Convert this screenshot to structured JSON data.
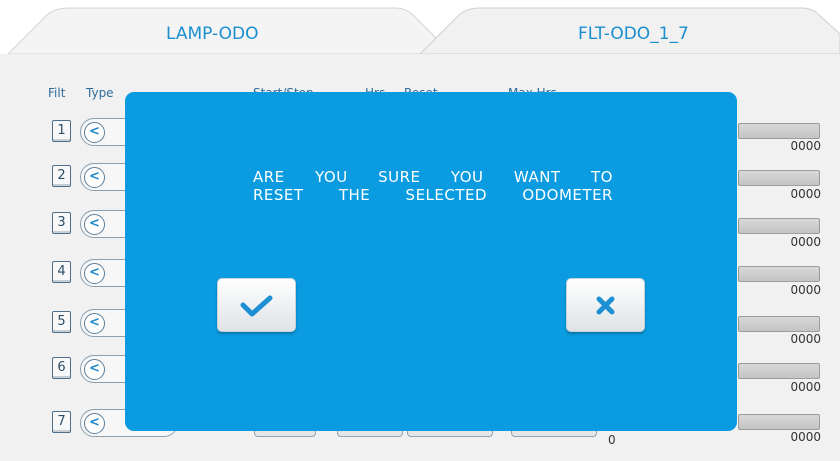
{
  "tabs": [
    {
      "label": "LAMP-ODO",
      "active": false
    },
    {
      "label": "FLT-ODO_1_7",
      "active": true
    }
  ],
  "table": {
    "headers": {
      "filt": "Filt",
      "type": "Type",
      "start_stop": "Start/Stop",
      "hrs": "Hrs",
      "reset": "Reset",
      "max_hrs": "Max Hrs"
    },
    "rows": [
      {
        "filt": "1",
        "value": "0000"
      },
      {
        "filt": "2",
        "value": "0000"
      },
      {
        "filt": "3",
        "value": "0000"
      },
      {
        "filt": "4",
        "value": "0000"
      },
      {
        "filt": "5",
        "value": "0000"
      },
      {
        "filt": "6",
        "value": "0000"
      },
      {
        "filt": "7",
        "value": "0000"
      }
    ],
    "bottom_count": "0"
  },
  "dialog": {
    "line1": [
      "ARE",
      "YOU",
      "SURE",
      "YOU",
      "WANT",
      "TO"
    ],
    "line2": [
      "RESET",
      "THE",
      "SELECTED",
      "ODOMETER"
    ],
    "confirm_icon": "check-icon",
    "cancel_icon": "close-icon"
  },
  "colors": {
    "accent": "#1a8fd0",
    "dialog_bg": "#0a9be0",
    "panel_bg": "#f1f1f1"
  }
}
